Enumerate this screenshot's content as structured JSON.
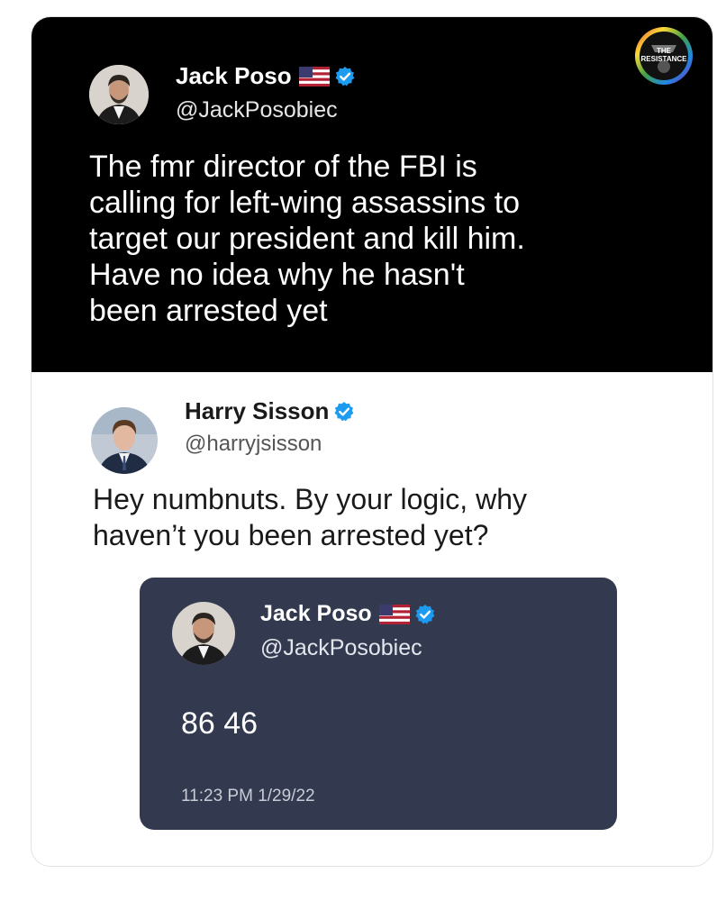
{
  "main_tweet": {
    "author_name": "Jack Poso",
    "author_handle": "@JackPosobiec",
    "verified": true,
    "flag_icon": "us-flag-icon",
    "text_lines": [
      "The fmr director of the FBI is",
      "calling for left-wing assassins to",
      "target our president and kill him.",
      "Have no idea why he hasn't",
      "been arrested yet"
    ],
    "background_color": "#000000"
  },
  "badge": {
    "label_line1": "THE",
    "label_line2": "RESISTANCE",
    "icon": "resistance-logo-icon"
  },
  "reply_tweet": {
    "author_name": "Harry Sisson",
    "author_handle": "@harryjsisson",
    "verified": true,
    "text_lines": [
      "Hey numbnuts. By your logic, why",
      "haven’t you been arrested yet?"
    ]
  },
  "quoted_tweet": {
    "author_name": "Jack Poso",
    "author_handle": "@JackPosobiec",
    "verified": true,
    "flag_icon": "us-flag-icon",
    "text": "86 46",
    "timestamp": "11:23 PM  1/29/22",
    "background_color": "#333a4f"
  },
  "colors": {
    "verified_blue": "#1d9bf0",
    "flag_red": "#b22234",
    "flag_blue": "#3c3b6e"
  }
}
